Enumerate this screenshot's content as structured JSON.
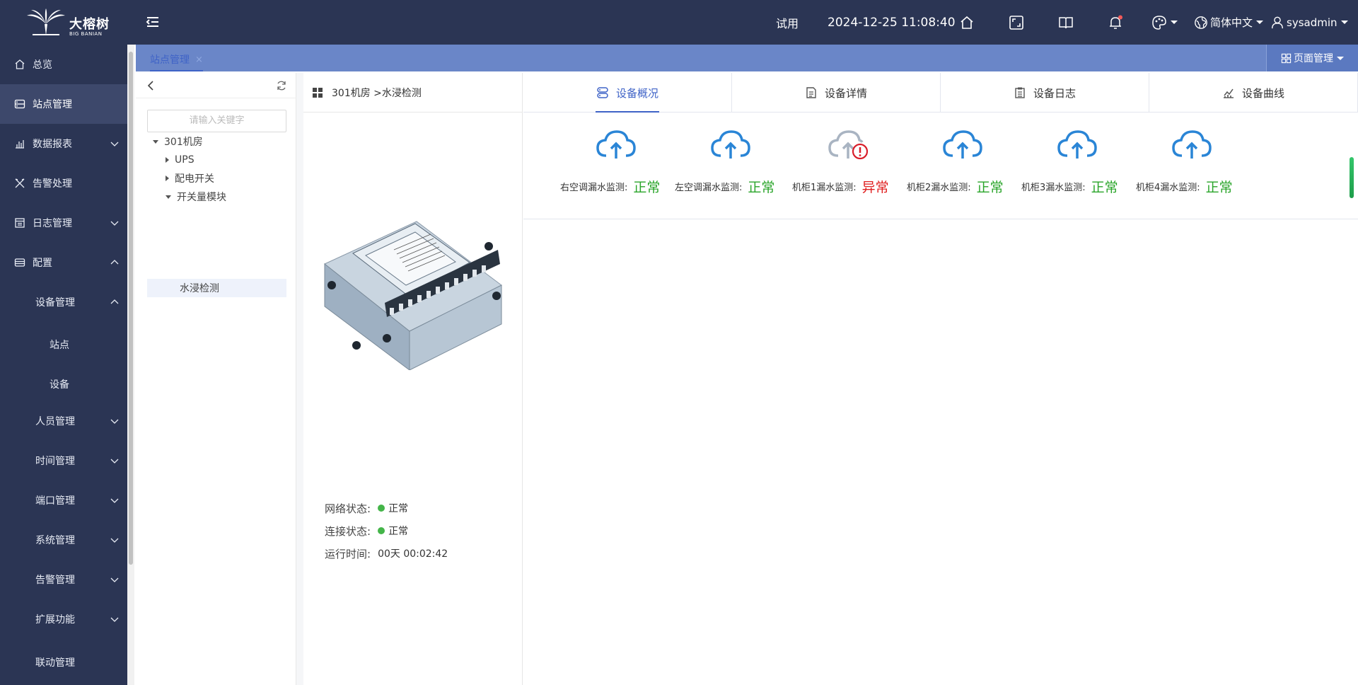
{
  "header": {
    "logo_text": "大榕树",
    "logo_sub": "BIG BANIAN",
    "trial": "试用",
    "datetime": "2024-12-25 11:08:40",
    "language": "简体中文",
    "user": "sysadmin"
  },
  "sidebar": {
    "items": [
      {
        "label": "总览"
      },
      {
        "label": "站点管理"
      },
      {
        "label": "数据报表"
      },
      {
        "label": "告警处理"
      },
      {
        "label": "日志管理"
      },
      {
        "label": "配置"
      },
      {
        "label": "设备管理"
      },
      {
        "label": "站点"
      },
      {
        "label": "设备"
      },
      {
        "label": "人员管理"
      },
      {
        "label": "时间管理"
      },
      {
        "label": "端口管理"
      },
      {
        "label": "系统管理"
      },
      {
        "label": "告警管理"
      },
      {
        "label": "扩展功能"
      },
      {
        "label": "联动管理"
      }
    ]
  },
  "tabs": {
    "active_tab": "站点管理",
    "close": "×",
    "page_manage": "页面管理"
  },
  "tree": {
    "search_placeholder": "请输入关键字",
    "nodes": [
      "301机房",
      "UPS",
      "配电开关",
      "开关量模块",
      "水浸检测"
    ]
  },
  "device": {
    "breadcrumb": "301机房 >水浸检测",
    "network_label": "网络状态:",
    "network_value": "正常",
    "connect_label": "连接状态:",
    "connect_value": "正常",
    "uptime_label": "运行时间:",
    "uptime_value": "00天 00:02:42"
  },
  "main_tabs": [
    "设备概况",
    "设备详情",
    "设备日志",
    "设备曲线"
  ],
  "sensors": [
    {
      "label": "右空调漏水监测:",
      "value": "正常",
      "status": "ok"
    },
    {
      "label": "左空调漏水监测:",
      "value": "正常",
      "status": "ok"
    },
    {
      "label": "机柜1漏水监测:",
      "value": "异常",
      "status": "bad"
    },
    {
      "label": "机柜2漏水监测:",
      "value": "正常",
      "status": "ok"
    },
    {
      "label": "机柜3漏水监测:",
      "value": "正常",
      "status": "ok"
    },
    {
      "label": "机柜4漏水监测:",
      "value": "正常",
      "status": "ok"
    }
  ],
  "colors": {
    "ok": "#2aa52a",
    "bad": "#e02020",
    "accent": "#3f63c7",
    "sidebar": "#2b3554"
  }
}
